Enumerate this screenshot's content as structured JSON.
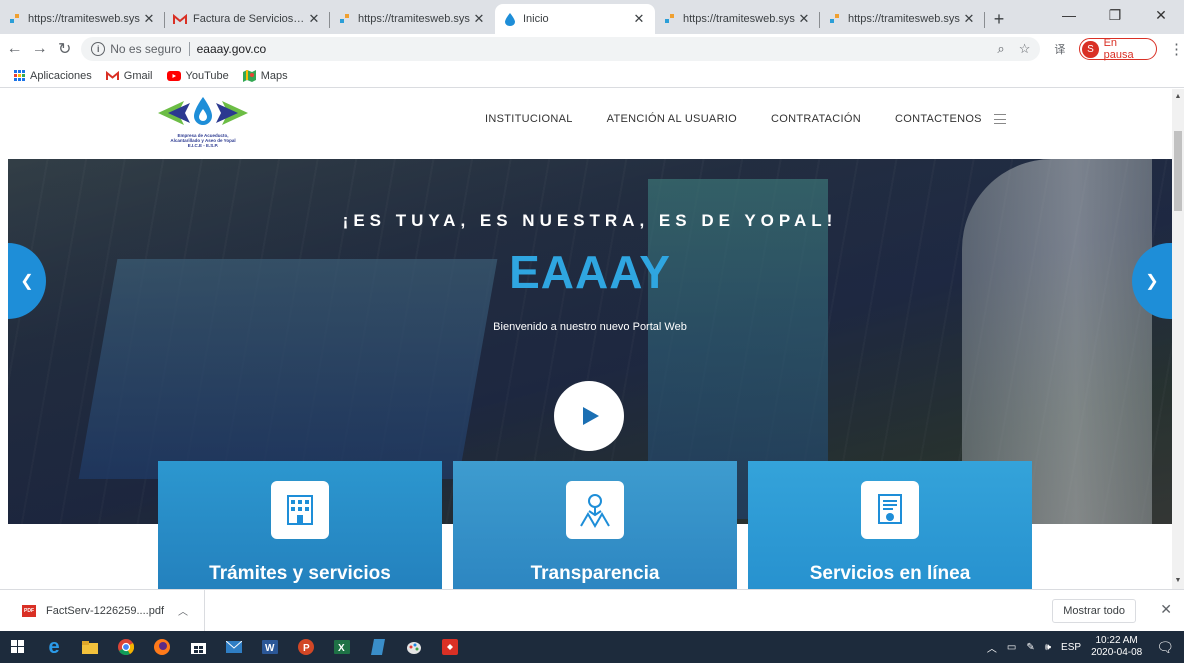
{
  "browser": {
    "tabs": [
      {
        "title": "https://tramitesweb.sys",
        "icon": "tramites-favicon-icon"
      },
      {
        "title": "Factura de Servicios Pu",
        "icon": "gmail-icon"
      },
      {
        "title": "https://tramitesweb.sys",
        "icon": "tramites-favicon-icon"
      },
      {
        "title": "Inicio",
        "icon": "water-drop-icon",
        "active": true
      },
      {
        "title": "https://tramitesweb.sys",
        "icon": "tramites-favicon-icon"
      },
      {
        "title": "https://tramitesweb.sys",
        "icon": "tramites-favicon-icon"
      }
    ],
    "security_text": "No es seguro",
    "url": "eaaay.gov.co",
    "profile_letter": "S",
    "profile_status": "En pausa",
    "bookmarks": [
      {
        "label": "Aplicaciones"
      },
      {
        "label": "Gmail"
      },
      {
        "label": "YouTube"
      },
      {
        "label": "Maps"
      }
    ]
  },
  "site": {
    "logo_lines": [
      "Empresa de Acueducto,",
      "Alcantarillado y Aseo de Yopal",
      "E.I.C.E - E.S.P."
    ],
    "nav": [
      "INSTITUCIONAL",
      "ATENCIÓN AL USUARIO",
      "CONTRATACIÓN",
      "CONTACTENOS"
    ],
    "hero": {
      "tagline": "¡ES TUYA, ES NUESTRA, ES DE YOPAL!",
      "brand": "EAAAY",
      "welcome": "Bienvenido a nuestro nuevo Portal Web"
    },
    "cards": [
      {
        "label": "Trámites y servicios",
        "icon": "building-icon"
      },
      {
        "label": "Transparencia",
        "icon": "transparency-icon"
      },
      {
        "label": "Servicios en línea",
        "icon": "certificate-icon"
      }
    ]
  },
  "downloads": {
    "file": "FactServ-1226259....pdf",
    "show_all": "Mostrar todo"
  },
  "taskbar": {
    "language": "ESP",
    "time": "10:22 AM",
    "date": "2020-04-08"
  },
  "colors": {
    "accent": "#1e8ed8",
    "brand_text": "#2fa6e1",
    "tabstrip": "#dee1e6",
    "taskbar": "#1d2b3c"
  }
}
